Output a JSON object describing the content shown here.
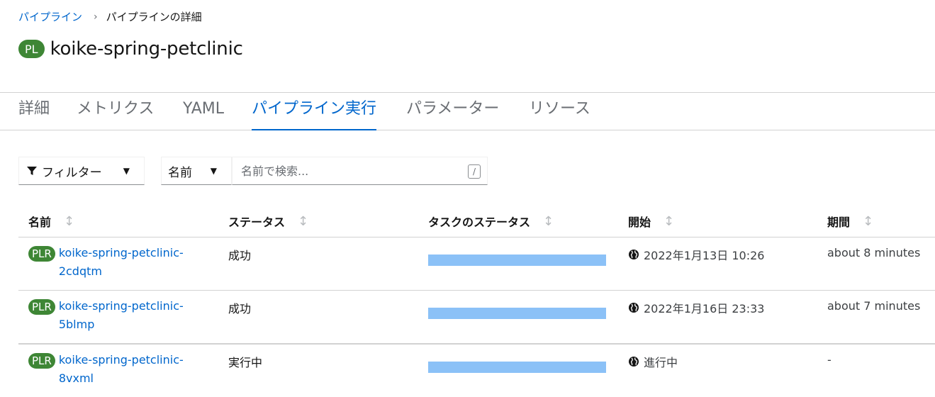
{
  "breadcrumb": {
    "parent": "パイプライン",
    "separator": "›",
    "current": "パイプラインの詳細"
  },
  "header": {
    "badge": "PL",
    "title": "koike-spring-petclinic"
  },
  "tabs": [
    {
      "label": "詳細",
      "active": false
    },
    {
      "label": "メトリクス",
      "active": false
    },
    {
      "label": "YAML",
      "active": false
    },
    {
      "label": "パイプライン実行",
      "active": true
    },
    {
      "label": "パラメーター",
      "active": false
    },
    {
      "label": "リソース",
      "active": false
    }
  ],
  "toolbar": {
    "filter_label": "フィルター",
    "attribute_label": "名前",
    "search_placeholder": "名前で検索...",
    "shortcut_key": "/"
  },
  "table": {
    "columns": [
      "名前",
      "ステータス",
      "タスクのステータス",
      "開始",
      "期間"
    ],
    "rows": [
      {
        "badge": "PLR",
        "name_line1": "koike-spring-petclinic-",
        "name_line2": "2cdqtm",
        "status": "成功",
        "started": "2022年1月13日 10:26",
        "duration": "about 8 minutes"
      },
      {
        "badge": "PLR",
        "name_line1": "koike-spring-petclinic-",
        "name_line2": "5blmp",
        "status": "成功",
        "started": "2022年1月16日 23:33",
        "duration": "about 7 minutes"
      },
      {
        "badge": "PLR",
        "name_line1": "koike-spring-petclinic-",
        "name_line2": "8vxml",
        "status": "実行中",
        "started": "進行中",
        "duration": "-"
      }
    ]
  },
  "colors": {
    "link": "#0066cc",
    "badge": "#3e8635",
    "task_bar": "#8bc1f7"
  }
}
